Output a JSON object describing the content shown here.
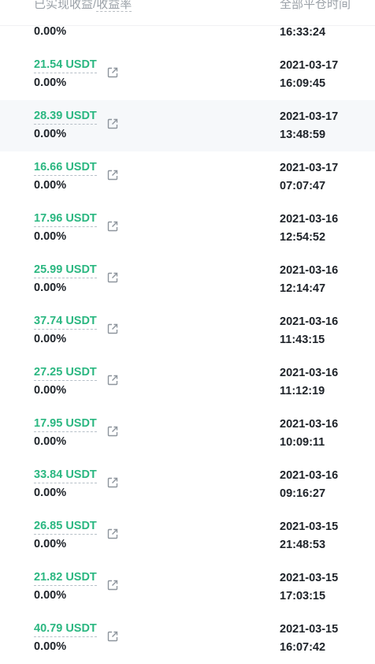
{
  "header": {
    "profit_label": "已实现收益",
    "separator": "/",
    "rate_label": "收益率",
    "close_time_label": "全部平仓时间"
  },
  "partial_row": {
    "rate": "0.00%",
    "time": "16:33:24"
  },
  "rows": [
    {
      "profit": "21.54 USDT",
      "rate": "0.00%",
      "date": "2021-03-17",
      "time": "16:09:45"
    },
    {
      "profit": "28.39 USDT",
      "rate": "0.00%",
      "date": "2021-03-17",
      "time": "13:48:59"
    },
    {
      "profit": "16.66 USDT",
      "rate": "0.00%",
      "date": "2021-03-17",
      "time": "07:07:47"
    },
    {
      "profit": "17.96 USDT",
      "rate": "0.00%",
      "date": "2021-03-16",
      "time": "12:54:52"
    },
    {
      "profit": "25.99 USDT",
      "rate": "0.00%",
      "date": "2021-03-16",
      "time": "12:14:47"
    },
    {
      "profit": "37.74 USDT",
      "rate": "0.00%",
      "date": "2021-03-16",
      "time": "11:43:15"
    },
    {
      "profit": "27.25 USDT",
      "rate": "0.00%",
      "date": "2021-03-16",
      "time": "11:12:19"
    },
    {
      "profit": "17.95 USDT",
      "rate": "0.00%",
      "date": "2021-03-16",
      "time": "10:09:11"
    },
    {
      "profit": "33.84 USDT",
      "rate": "0.00%",
      "date": "2021-03-16",
      "time": "09:16:27"
    },
    {
      "profit": "26.85 USDT",
      "rate": "0.00%",
      "date": "2021-03-15",
      "time": "21:48:53"
    },
    {
      "profit": "21.82 USDT",
      "rate": "0.00%",
      "date": "2021-03-15",
      "time": "17:03:15"
    },
    {
      "profit": "40.79 USDT",
      "rate": "0.00%",
      "date": "2021-03-15",
      "time": "16:07:42"
    }
  ],
  "colors": {
    "profit_positive": "#2bb781",
    "text_primary": "#1e2329",
    "text_muted": "#9aa0a7",
    "hover_row": "#f6f8fa"
  },
  "icons": {
    "row_action": "share-icon"
  }
}
